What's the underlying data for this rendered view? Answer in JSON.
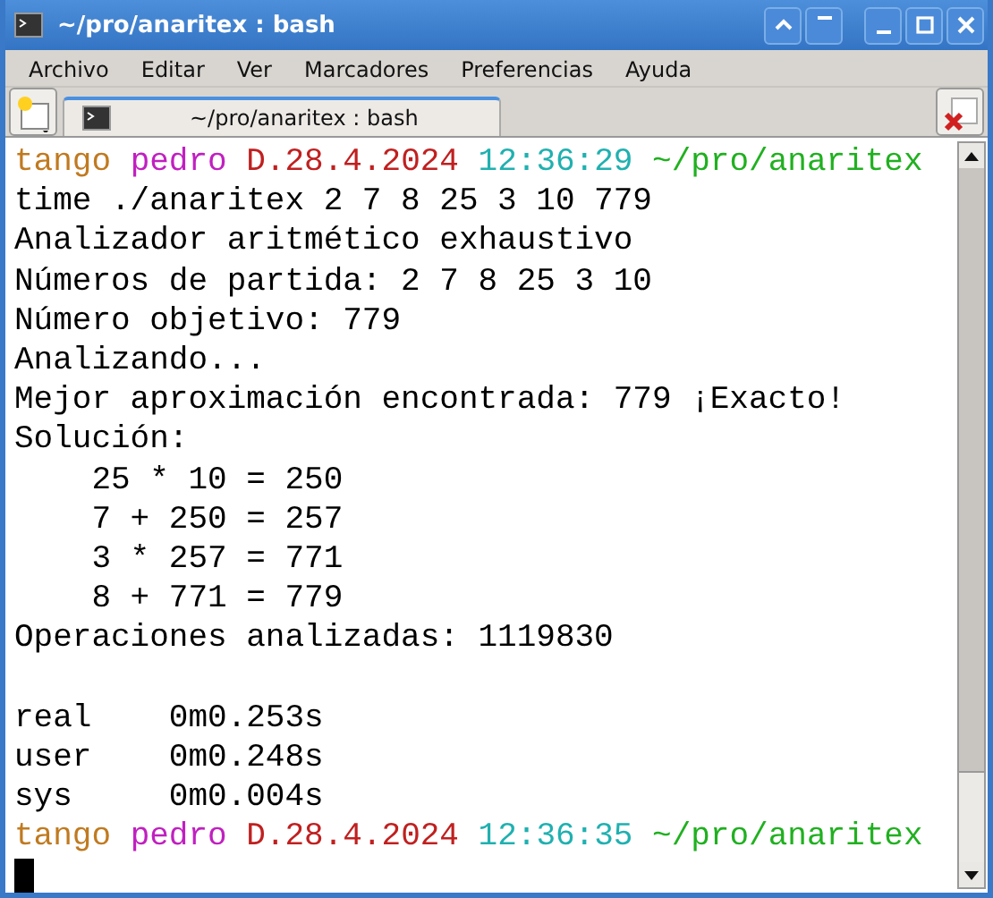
{
  "window": {
    "title": "~/pro/anaritex : bash"
  },
  "menu": [
    "Archivo",
    "Editar",
    "Ver",
    "Marcadores",
    "Preferencias",
    "Ayuda"
  ],
  "tabs": [
    {
      "label": "~/pro/anaritex : bash",
      "selected": true
    }
  ],
  "terminal": {
    "lines": [
      {
        "kind": "prompt",
        "segments": [
          {
            "text": "tango",
            "color": "#c07a20"
          },
          {
            "text": "pedro",
            "color": "#c020c0"
          },
          {
            "text": "D.28.4.2024",
            "color": "#c02020"
          },
          {
            "text": "12:36:29",
            "color": "#20b0b0"
          },
          {
            "text": "~/pro/anaritex",
            "color": "#20b020"
          }
        ]
      },
      {
        "kind": "text",
        "text": "time ./anaritex 2 7 8 25 3 10 779"
      },
      {
        "kind": "text",
        "text": "Analizador aritmético exhaustivo"
      },
      {
        "kind": "text",
        "text": "Números de partida: 2 7 8 25 3 10"
      },
      {
        "kind": "text",
        "text": "Número objetivo: 779"
      },
      {
        "kind": "text",
        "text": "Analizando..."
      },
      {
        "kind": "text",
        "text": "Mejor aproximación encontrada: 779 ¡Exacto!"
      },
      {
        "kind": "text",
        "text": "Solución:"
      },
      {
        "kind": "text",
        "text": "    25 * 10 = 250"
      },
      {
        "kind": "text",
        "text": "    7 + 250 = 257"
      },
      {
        "kind": "text",
        "text": "    3 * 257 = 771"
      },
      {
        "kind": "text",
        "text": "    8 + 771 = 779"
      },
      {
        "kind": "text",
        "text": "Operaciones analizadas: 1119830"
      },
      {
        "kind": "blank"
      },
      {
        "kind": "text",
        "text": "real    0m0.253s"
      },
      {
        "kind": "text",
        "text": "user    0m0.248s"
      },
      {
        "kind": "text",
        "text": "sys     0m0.004s"
      },
      {
        "kind": "prompt",
        "segments": [
          {
            "text": "tango",
            "color": "#c07a20"
          },
          {
            "text": "pedro",
            "color": "#c020c0"
          },
          {
            "text": "D.28.4.2024",
            "color": "#c02020"
          },
          {
            "text": "12:36:35",
            "color": "#20b0b0"
          },
          {
            "text": "~/pro/anaritex",
            "color": "#20b020"
          }
        ]
      },
      {
        "kind": "cursor"
      }
    ]
  }
}
